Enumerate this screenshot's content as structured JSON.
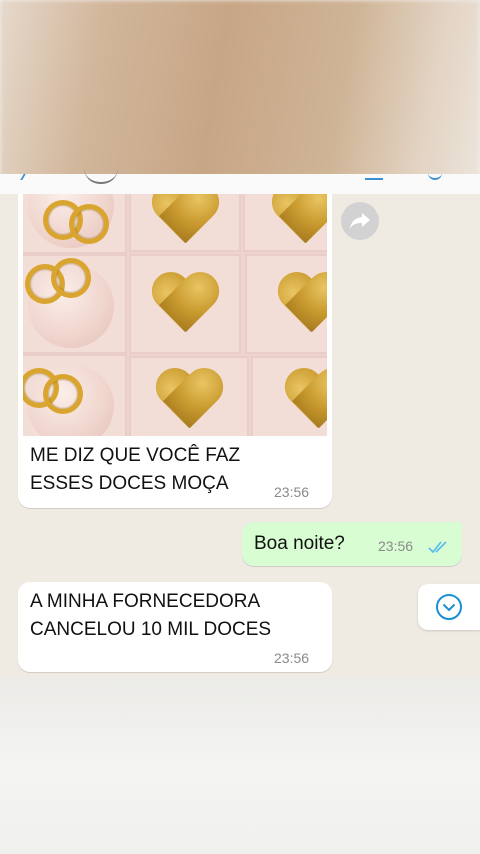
{
  "colors": {
    "chat_background": "#efeae2",
    "incoming_bubble": "#ffffff",
    "outgoing_bubble": "#d9fdd3",
    "read_ticks": "#53bdeb",
    "accent_blue": "#1b8fd6"
  },
  "messages": [
    {
      "direction": "incoming",
      "type": "image",
      "caption_line1": "ME DIZ QUE VOCÊ FAZ",
      "caption_line2": "ESSES DOCES MOÇA",
      "time": "23:56"
    },
    {
      "direction": "outgoing",
      "text": "Boa noite?",
      "time": "23:56",
      "status_icon": "double-check-icon"
    },
    {
      "direction": "incoming",
      "text_line1": "A MINHA FORNECEDORA",
      "text_line2": "CANCELOU 10 MIL DOCES",
      "time": "23:56"
    }
  ],
  "icons": {
    "forward": "forward-icon",
    "scroll_down": "chevron-down-icon"
  }
}
